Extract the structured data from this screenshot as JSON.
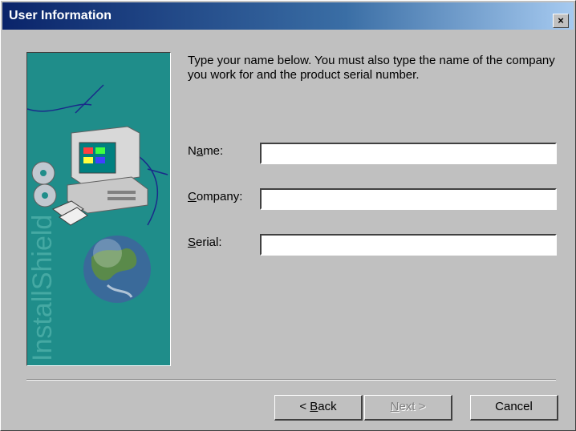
{
  "window": {
    "title": "User Information",
    "close_symbol": "×"
  },
  "graphic": {
    "brand_text": "InstallShield"
  },
  "instructions": "Type your name below. You must also type the name of the company you work for and the product serial number.",
  "fields": {
    "name": {
      "label_prefix": "N",
      "label_underlined": "a",
      "label_suffix": "me:",
      "value": ""
    },
    "company": {
      "label_prefix": "",
      "label_underlined": "C",
      "label_suffix": "ompany:",
      "value": ""
    },
    "serial": {
      "label_prefix": "",
      "label_underlined": "S",
      "label_suffix": "erial:",
      "value": ""
    }
  },
  "buttons": {
    "back": {
      "prefix": "< ",
      "underlined": "B",
      "suffix": "ack"
    },
    "next": {
      "prefix": "",
      "underlined": "N",
      "suffix": "ext >"
    },
    "cancel": {
      "label": "Cancel"
    }
  }
}
